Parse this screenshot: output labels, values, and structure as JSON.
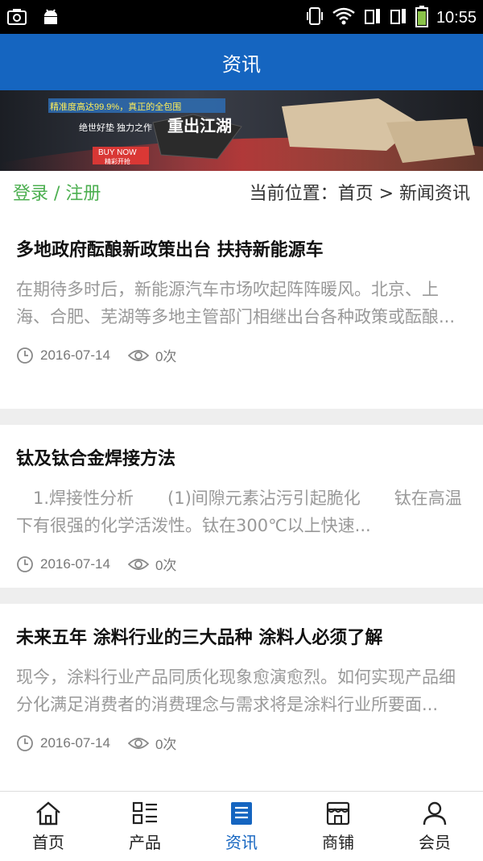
{
  "status": {
    "time": "10:55"
  },
  "header": {
    "title": "资讯"
  },
  "banner": {
    "tag1": "精准度高达99.9%，真正的全包围",
    "tag2": "绝世好垫 独力之作",
    "slogan": "重出江湖",
    "cta": "BUY NOW",
    "cta_sub": "精彩开抢"
  },
  "crumbbar": {
    "login": "登录 / 注册",
    "breadcrumb": "当前位置：首页 > 新闻资讯"
  },
  "articles": [
    {
      "title": "多地政府酝酿新政策出台 扶持新能源车",
      "summary": "在期待多时后，新能源汽车市场吹起阵阵暖风。北京、上海、合肥、芜湖等多地主管部门相继出台各种政策或酝酿...",
      "date": "2016-07-14",
      "views": "0次"
    },
    {
      "title": "钛及钛合金焊接方法",
      "summary": "　1.焊接性分析　　(1)间隙元素沾污引起脆化　　钛在高温下有很强的化学活泼性。钛在300℃以上快速...",
      "date": "2016-07-14",
      "views": "0次"
    },
    {
      "title": "未来五年 涂料行业的三大品种 涂料人必须了解",
      "summary": "现今，涂料行业产品同质化现象愈演愈烈。如何实现产品细分化满足消费者的消费理念与需求将是涂料行业所要面...",
      "date": "2016-07-14",
      "views": "0次"
    }
  ],
  "tabs": [
    {
      "label": "首页",
      "icon": "home-icon"
    },
    {
      "label": "产品",
      "icon": "product-grid-icon"
    },
    {
      "label": "资讯",
      "icon": "news-icon",
      "active": true
    },
    {
      "label": "商铺",
      "icon": "store-icon"
    },
    {
      "label": "会员",
      "icon": "user-icon"
    }
  ],
  "colors": {
    "primary": "#1565c0",
    "login": "#4caf50",
    "summary": "#999999"
  }
}
